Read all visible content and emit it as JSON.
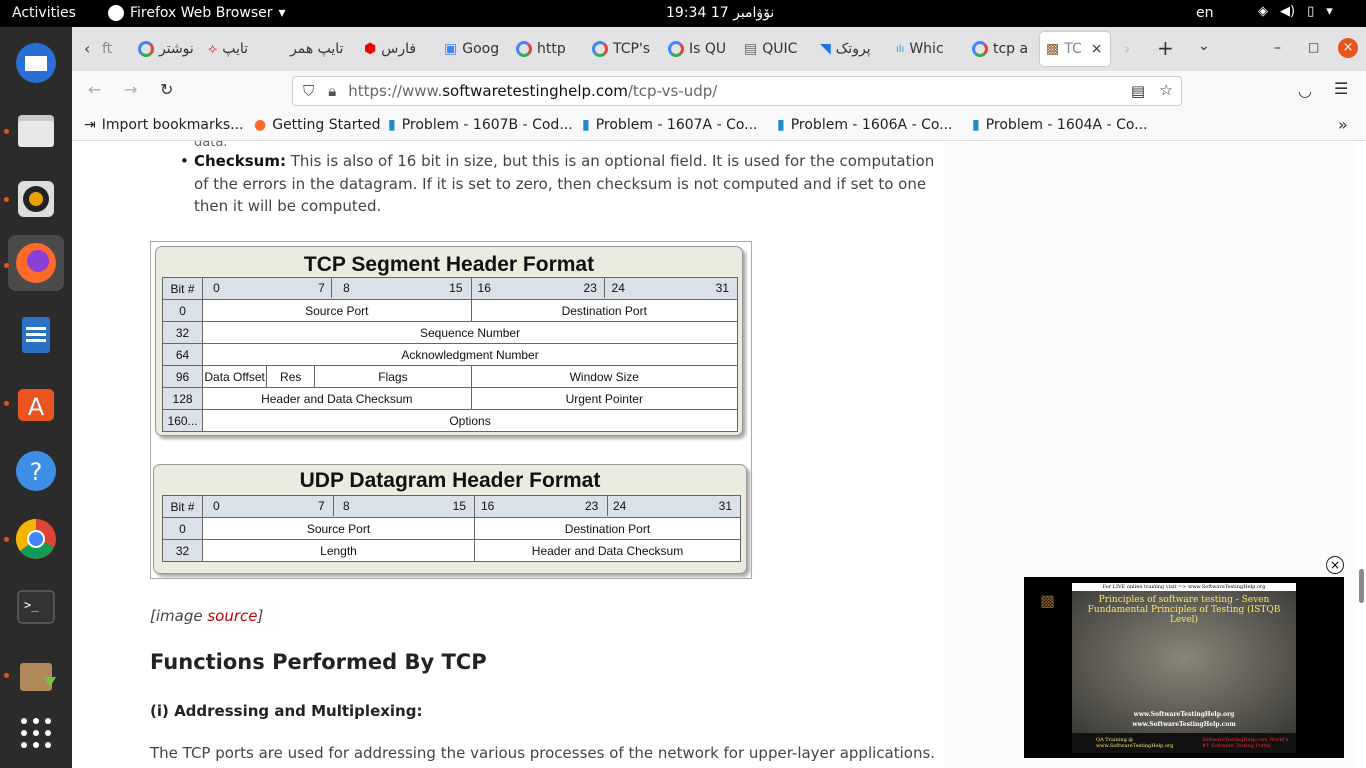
{
  "topbar": {
    "activities": "Activities",
    "app": "Firefox Web Browser",
    "clock": "نۆۋامبر 17  19:34",
    "lang": "en"
  },
  "tabs": [
    {
      "label": "ft"
    },
    {
      "label": "نوشتر"
    },
    {
      "label": "تايپ"
    },
    {
      "label": "تايپ همر"
    },
    {
      "label": "فارس"
    },
    {
      "label": "Goog"
    },
    {
      "label": "http"
    },
    {
      "label": "TCP's"
    },
    {
      "label": "Is QU"
    },
    {
      "label": "QUIC"
    },
    {
      "label": "پروتک"
    },
    {
      "label": "Whic"
    },
    {
      "label": "tcp a"
    },
    {
      "label": "TC"
    }
  ],
  "nav": {
    "url_prefix": "https://www.",
    "url_domain": "softwaretestinghelp.com",
    "url_path": "/tcp-vs-udp/"
  },
  "bookmarks": [
    {
      "label": "Import bookmarks..."
    },
    {
      "label": "Getting Started"
    },
    {
      "label": "Problem - 1607B - Cod..."
    },
    {
      "label": "Problem - 1607A - Co..."
    },
    {
      "label": "Problem - 1606A - Co..."
    },
    {
      "label": "Problem - 1604A - Co..."
    }
  ],
  "article": {
    "cut_text": "data.",
    "checksum_label": "Checksum:",
    "checksum_text": " This is also of 16 bit in size, but this is an optional field. It is used for the computation",
    "checksum_text2": "of the errors in the datagram. If it is set to zero, then checksum is not computed and if set to one",
    "checksum_text3": "then it will be computed.",
    "image_caption_pre": "[image ",
    "image_caption_link": "source",
    "image_caption_post": "]",
    "heading": "Functions Performed By TCP",
    "subheading": "(i) Addressing and Multiplexing:",
    "body": "The TCP ports are used for addressing the various processes of the network for upper-layer applications."
  },
  "tcp": {
    "title": "TCP Segment Header Format",
    "bit_label": "Bit #",
    "bits": [
      "0",
      "7",
      "8",
      "15",
      "16",
      "23",
      "24",
      "31"
    ],
    "rows": [
      {
        "num": "0",
        "a": "Source Port",
        "b": "Destination Port"
      },
      {
        "num": "32",
        "full": "Sequence Number"
      },
      {
        "num": "64",
        "full": "Acknowledgment Number"
      },
      {
        "num": "96",
        "c1": "Data Offset",
        "c2": "Res",
        "c3": "Flags",
        "b": "Window Size"
      },
      {
        "num": "128",
        "a": "Header and Data Checksum",
        "b": "Urgent Pointer"
      },
      {
        "num": "160...",
        "full": "Options"
      }
    ]
  },
  "udp": {
    "title": "UDP Datagram Header Format",
    "bit_label": "Bit #",
    "bits": [
      "0",
      "7",
      "8",
      "15",
      "16",
      "23",
      "24",
      "31"
    ],
    "rows": [
      {
        "num": "0",
        "a": "Source Port",
        "b": "Destination Port"
      },
      {
        "num": "32",
        "a": "Length",
        "b": "Header and Data Checksum"
      }
    ]
  },
  "video": {
    "top": "For LIVE online training visit => www.SoftwareTestingHelp.org",
    "title": "Principles of software testing - Seven Fundamental Principles of Testing (ISTQB Level)",
    "site1": "www.SoftwareTestingHelp.org",
    "site2": "www.SoftwareTestingHelp.com",
    "foot_left": "QA Training @ www.SoftwareTestingHelp.org",
    "foot_right": "SoftwareTestingHelp.com World's #1 Software Testing Portal"
  }
}
